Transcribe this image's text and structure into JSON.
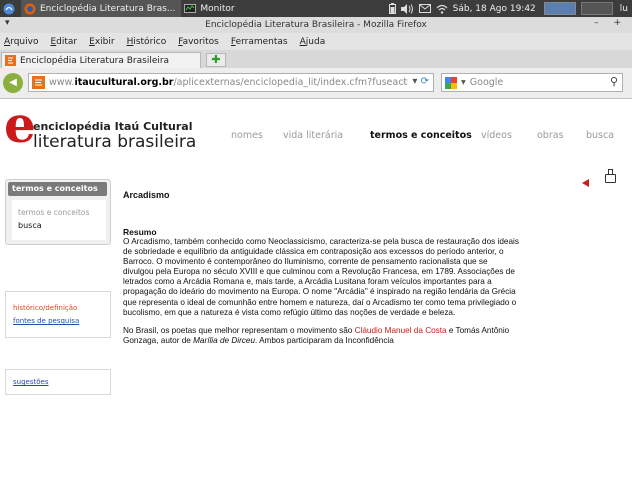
{
  "panel": {
    "task1": "Enciclopédia Literatura Bras...",
    "task2": "Monitor",
    "datetime": "Sáb, 18 Ago 19:42",
    "user": "lu"
  },
  "window": {
    "title": "Enciclopédia Literatura Brasileira - Mozilla Firefox",
    "minmax": "– +"
  },
  "menu": [
    "Arquivo",
    "Editar",
    "Exibir",
    "Histórico",
    "Favoritos",
    "Ferramentas",
    "Ajuda"
  ],
  "tab": {
    "title": "Enciclopédia Literatura Brasileira"
  },
  "address": {
    "prefix": "www.",
    "domain": "itaucultural.org.br",
    "path": "/aplicexternas/enciclopedia_lit/index.cfm?fuseact"
  },
  "search": {
    "placeholder": "Google"
  },
  "logo": {
    "line1": "enciclopédia Itaú Cultural",
    "line2": "literatura brasileira"
  },
  "site_nav": [
    "nomes",
    "vida literária",
    "termos e conceitos",
    "vídeos",
    "obras",
    "busca"
  ],
  "sidebar": {
    "box_title": "termos e conceitos",
    "box_item1": "termos e conceitos",
    "box_item2": "busca",
    "link_historico": "histórico/definição",
    "link_fontes": "fontes de pesquisa",
    "link_sugestoes": "sugestões"
  },
  "article": {
    "title": "Arcadismo",
    "subtitle": "Resumo",
    "paragraph1": "O Arcadismo, também conhecido como Neoclassicismo, caracteriza-se pela busca de restauração dos ideais de sobriedade e equilíbrio da antiguidade clássica em contraposição aos excessos do período anterior, o Barroco. O movimento é contemporâneo do Iluminismo, corrente de pensamento racionalista que se divulgou pela Europa no século XVIII e que culminou com a Revolução Francesa, em 1789. Associações de letrados como a Arcádia Romana e, mais tarde, a Arcádia Lusitana foram veículos importantes para a propagação do ideário do movimento na Europa. O nome \"Arcádia\" é inspirado na região lendária da Grécia que representa o ideal de comunhão entre homem e natureza, daí o Arcadismo ter como tema privilegiado o bucolismo, em que a natureza é vista como refúgio último das noções de verdade e beleza.",
    "p2_start": "No Brasil, os poetas que melhor representam o movimento são ",
    "p2_link": "Cláudio Manuel da Costa",
    "p2_mid": " e Tomás Antônio Gonzaga, autor de ",
    "p2_italic": "Marília de Dirceu",
    "p2_end": ". Ambos participaram da Inconfidência"
  },
  "colors": {
    "brand_red": "#cc1a1a",
    "nav_grey": "#9a9a9a"
  }
}
